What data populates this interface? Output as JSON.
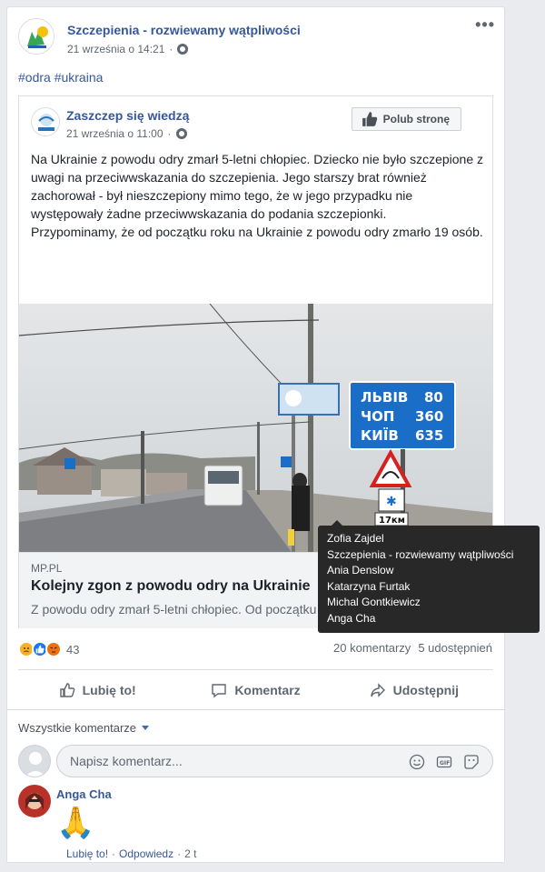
{
  "post": {
    "page_name": "Szczepienia - rozwiewamy wątpliwości",
    "timestamp": "21 września o 14:21",
    "hashtags": "#odra #ukraina",
    "more_icon": "ellipsis-icon"
  },
  "shared": {
    "page_name": "Zaszczep się wiedzą",
    "timestamp": "21 września o 11:00",
    "like_page_label": "Polub stronę",
    "text_p1": "Na Ukrainie z powodu odry zmarł 5-letni chłopiec. Dziecko nie było szczepione z uwagi na przeciwwskazania do szczepienia. Jego starszy brat również zachorował - był nieszczepiony mimo tego, że w jego przypadku nie występowały żadne przeciwwskazania do podania szczepionki.",
    "text_p2": "Przypominamy, że od początku roku na Ukrainie z powodu odry zmarło 19 osób.",
    "photo": {
      "sign_line1_city": "ЛЬВІВ",
      "sign_line1_km": "80",
      "sign_line2_city": "ЧОП",
      "sign_line2_km": "360",
      "sign_line3_city": "КИЇВ",
      "sign_line3_km": "635",
      "plate_text": "17км"
    },
    "link": {
      "domain": "MP.PL",
      "title": "Kolejny zgon z powodu odry na Ukrainie",
      "description": "Z powodu odry zmarł 5-letni chłopiec. Od początku roku na Ukrainie..."
    }
  },
  "stats": {
    "reaction_count": "43",
    "comments": "20 komentarzy",
    "shares": "5 udostępnień"
  },
  "tooltip": {
    "names": [
      "Zofia Zajdel",
      "Szczepienia - rozwiewamy wątpliwości",
      "Ania Denslow",
      "Katarzyna Furtak",
      "Michal Gontkiewicz",
      "Anga Cha"
    ]
  },
  "actions": {
    "like": "Lubię to!",
    "comment": "Komentarz",
    "share": "Udostępnij"
  },
  "comments": {
    "filter_label": "Wszystkie komentarze",
    "input_placeholder": "Napisz komentarz...",
    "items": [
      {
        "author": "Anga Cha",
        "content": "🙏",
        "like_label": "Lubię to!",
        "reply_label": "Odpowiedz",
        "time": "2 t"
      }
    ]
  },
  "colors": {
    "link_blue": "#365899",
    "like_blue": "#1877f2",
    "sign_blue": "#1a6ec7"
  }
}
